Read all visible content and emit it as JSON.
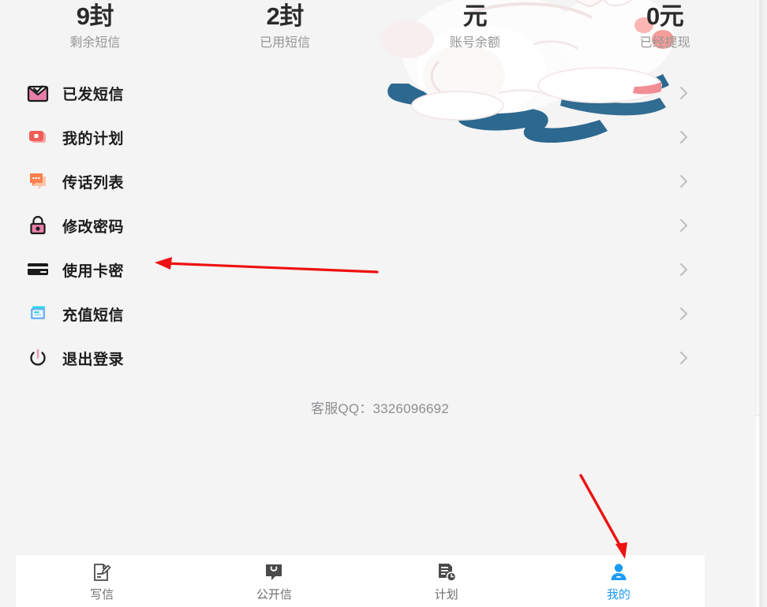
{
  "theme": {
    "page_bg": "#f4f4f4",
    "accent_blue": "#1c9bf5",
    "text_primary": "#1c1c1c",
    "text_muted": "#969696",
    "annotation_red": "#ee1111",
    "rabbit_outline": "#1c5d86",
    "rabbit_pink": "#f4928f"
  },
  "stats": [
    {
      "value": "9封",
      "label": "剩余短信"
    },
    {
      "value": "2封",
      "label": "已用短信"
    },
    {
      "value": "元",
      "label": "账号余额"
    },
    {
      "value": "0元",
      "label": "已经提现"
    }
  ],
  "menu": {
    "items": [
      {
        "label": "已发短信",
        "icon": "envelope-check-icon",
        "chevron": "chevron-right-icon"
      },
      {
        "label": "我的计划",
        "icon": "plan-card-icon",
        "chevron": "chevron-right-icon"
      },
      {
        "label": "传话列表",
        "icon": "chat-bubble-icon",
        "chevron": "chevron-right-icon"
      },
      {
        "label": "修改密码",
        "icon": "lock-icon",
        "chevron": "chevron-right-icon"
      },
      {
        "label": "使用卡密",
        "icon": "credit-card-icon",
        "chevron": "chevron-right-icon"
      },
      {
        "label": "充值短信",
        "icon": "recharge-card-icon",
        "chevron": "chevron-right-icon"
      },
      {
        "label": "退出登录",
        "icon": "power-icon",
        "chevron": "chevron-right-icon"
      }
    ]
  },
  "support": {
    "text": "客服QQ：3326096692"
  },
  "tabbar": {
    "tabs": [
      {
        "label": "写信",
        "icon": "compose-icon",
        "active": false
      },
      {
        "label": "公开信",
        "icon": "public-letter-icon",
        "active": false
      },
      {
        "label": "计划",
        "icon": "plan-clock-icon",
        "active": false
      },
      {
        "label": "我的",
        "icon": "person-icon",
        "active": true
      }
    ]
  },
  "illustration": {
    "name": "rabbit-illustration"
  },
  "annotations": [
    {
      "name": "arrow-to-use-card-code",
      "target": "使用卡密"
    },
    {
      "name": "arrow-to-mine-tab",
      "target": "我的"
    }
  ]
}
